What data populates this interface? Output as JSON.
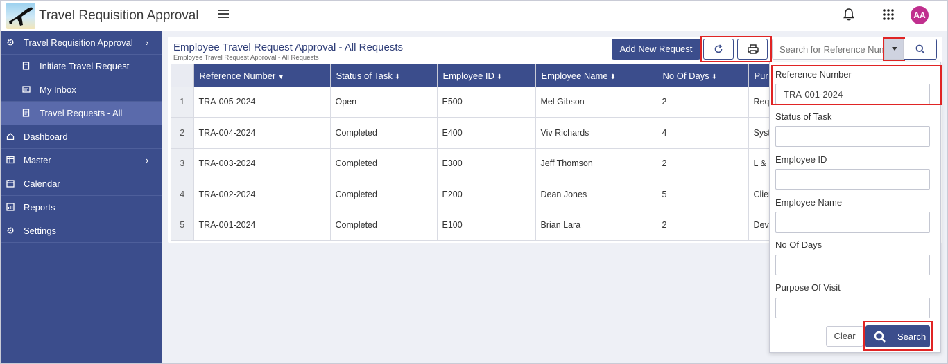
{
  "app": {
    "title": "Travel Requisition Approval",
    "avatar_initials": "AA",
    "accent": "#3b4d8c",
    "avatar_color": "#c02f8e"
  },
  "sidebar": {
    "items": [
      {
        "label": "Travel Requisition Approval",
        "icon": "gear-icon",
        "has_chevron": true
      },
      {
        "label": "Initiate Travel Request",
        "icon": "form-icon",
        "sub": true
      },
      {
        "label": "My Inbox",
        "icon": "inbox-icon",
        "sub": true
      },
      {
        "label": "Travel Requests - All",
        "icon": "list-icon",
        "sub": true,
        "active": true
      },
      {
        "label": "Dashboard",
        "icon": "home-icon"
      },
      {
        "label": "Master",
        "icon": "table-icon",
        "has_chevron": true
      },
      {
        "label": "Calendar",
        "icon": "calendar-icon"
      },
      {
        "label": "Reports",
        "icon": "chart-icon"
      },
      {
        "label": "Settings",
        "icon": "gear-icon"
      }
    ]
  },
  "page": {
    "title": "Employee Travel Request Approval - All Requests",
    "subtitle": "Employee Travel Request Approval - All Requests",
    "add_button": "Add New Request",
    "search_placeholder": "Search for Reference Number"
  },
  "table": {
    "columns": [
      "Reference Number",
      "Status of Task",
      "Employee ID",
      "Employee Name",
      "No Of Days",
      "Pur"
    ],
    "rows": [
      [
        "1",
        "TRA-005-2024",
        "Open",
        "E500",
        "Mel Gibson",
        "2",
        "Req"
      ],
      [
        "2",
        "TRA-004-2024",
        "Completed",
        "E400",
        "Viv Richards",
        "4",
        "Syst"
      ],
      [
        "3",
        "TRA-003-2024",
        "Completed",
        "E300",
        "Jeff Thomson",
        "2",
        "L & I"
      ],
      [
        "4",
        "TRA-002-2024",
        "Completed",
        "E200",
        "Dean Jones",
        "5",
        "Clien"
      ],
      [
        "5",
        "TRA-001-2024",
        "Completed",
        "E100",
        "Brian Lara",
        "2",
        "Deve"
      ]
    ]
  },
  "filter": {
    "fields": [
      {
        "label": "Reference Number",
        "value": "TRA-001-2024"
      },
      {
        "label": "Status of Task",
        "value": ""
      },
      {
        "label": "Employee ID",
        "value": ""
      },
      {
        "label": "Employee Name",
        "value": ""
      },
      {
        "label": "No Of Days",
        "value": ""
      },
      {
        "label": "Purpose Of Visit",
        "value": ""
      }
    ],
    "clear_label": "Clear",
    "search_label": "Search"
  }
}
